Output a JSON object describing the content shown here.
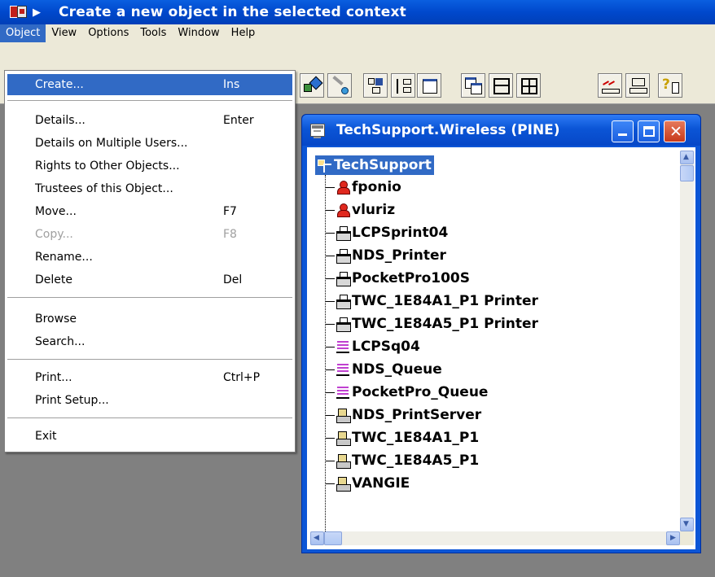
{
  "app": {
    "title": "Create a new object in the selected context"
  },
  "menubar": {
    "items": [
      {
        "label": "Object",
        "active": true
      },
      {
        "label": "View"
      },
      {
        "label": "Options"
      },
      {
        "label": "Tools"
      },
      {
        "label": "Window"
      },
      {
        "label": "Help"
      }
    ]
  },
  "object_menu": {
    "items": [
      {
        "label": "Create...",
        "shortcut": "Ins",
        "selected": true
      },
      {
        "label": "Details...",
        "shortcut": "Enter"
      },
      {
        "label": "Details on Multiple Users..."
      },
      {
        "label": "Rights to Other Objects..."
      },
      {
        "label": "Trustees of this Object..."
      },
      {
        "label": "Move...",
        "shortcut": "F7"
      },
      {
        "label": "Copy...",
        "shortcut": "F8",
        "disabled": true
      },
      {
        "label": "Rename..."
      },
      {
        "label": "Delete",
        "shortcut": "Del"
      },
      {
        "label": "Browse"
      },
      {
        "label": "Search..."
      },
      {
        "label": "Print...",
        "shortcut": "Ctrl+P"
      },
      {
        "label": "Print Setup..."
      },
      {
        "label": "Exit"
      }
    ]
  },
  "toolbar": {
    "icons": [
      "object-tree-icon",
      "assign-rights-icon",
      "users-icon",
      "browse-icon",
      "sort-icon",
      "partition-icon",
      "window-icon",
      "cascade-icon",
      "tile-icon",
      "report-icon",
      "grid-icon",
      "help-icon"
    ]
  },
  "browser_window": {
    "title": "TechSupport.Wireless (PINE)",
    "root": "TechSupport",
    "items": [
      {
        "label": "fponio",
        "icon": "user-icon"
      },
      {
        "label": "vluriz",
        "icon": "user-icon"
      },
      {
        "label": "LCPSprint04",
        "icon": "printer-icon"
      },
      {
        "label": "NDS_Printer",
        "icon": "printer-icon"
      },
      {
        "label": "PocketPro100S",
        "icon": "printer-icon"
      },
      {
        "label": "TWC_1E84A1_P1 Printer",
        "icon": "printer-icon"
      },
      {
        "label": "TWC_1E84A5_P1 Printer",
        "icon": "printer-icon"
      },
      {
        "label": "LCPSq04",
        "icon": "print-queue-icon"
      },
      {
        "label": "NDS_Queue",
        "icon": "print-queue-icon"
      },
      {
        "label": "PocketPro_Queue",
        "icon": "print-queue-icon"
      },
      {
        "label": "NDS_PrintServer",
        "icon": "print-server-icon"
      },
      {
        "label": "TWC_1E84A1_P1",
        "icon": "print-server-icon"
      },
      {
        "label": "TWC_1E84A5_P1",
        "icon": "print-server-icon"
      },
      {
        "label": "VANGIE",
        "icon": "print-server-icon"
      }
    ]
  }
}
